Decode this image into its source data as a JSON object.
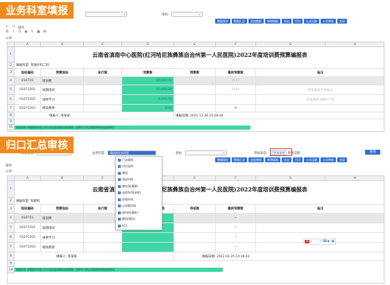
{
  "top": {
    "section_label": "业务科室填报",
    "filter_label": "指标:",
    "toolbar_label": "操作",
    "formula_label": "公式:",
    "buttons": [
      "数据保存",
      "数据汇总",
      "追加数据",
      "新增填报",
      "导出",
      "打印",
      "公式运算",
      "公式审核",
      "关闭"
    ],
    "columns": [
      "A",
      "B",
      "C",
      "D",
      "E",
      "F",
      "G",
      "H"
    ],
    "title": "云南省滇南中心医院(红河哈尼族彝族自治州第一人民医院)2022年度培训费预算编报表",
    "unit_line": "填报科室: 普通外科二科",
    "headers": [
      "指标编码",
      "预算指标",
      "执行数",
      "预算数",
      "预算数",
      "最终预算数",
      "备注"
    ],
    "rows": [
      {
        "num": "4",
        "code": "010715",
        "name": "培训费",
        "exec": "",
        "budget": "00,000.00",
        "b2": "",
        "final": "0000",
        "note": ""
      },
      {
        "num": "5",
        "code": "01071501",
        "name": "短期培训",
        "exec": "",
        "budget": "00,000.00",
        "b2": "",
        "final": "0000",
        "note": "参加相关学术会议"
      },
      {
        "num": "6",
        "code": "01071502",
        "name": "进修学习",
        "exec": "",
        "budget": "0,000.00",
        "b2": "",
        "final": "",
        "note": "外出进修 进修6个月"
      },
      {
        "num": "7",
        "code": "01071503",
        "name": "继续教育",
        "exec": "",
        "budget": "0.00",
        "b2": "",
        "final": "0",
        "note": ""
      }
    ],
    "sign_left": "填报人: 某某某",
    "sign_right": "填报日期: 2021-11-26 15:08:44",
    "note": "填报说明: 请根据本科室工作计划如实填报培训费预算，进修学习须注明进修时间及进修单位"
  },
  "bottom": {
    "section_label": "归口汇总审核",
    "filter_status_label": "审核状态:",
    "filter_dept_label": "业务科室:",
    "filter_dept_value": "请选择业务科室",
    "filter_indicator_label": "指标:",
    "filter_audit_label": "审核状态:",
    "filter_audit_value": "已完成审核",
    "filter_extra": "审核日期",
    "query_label": "查询",
    "toolbar_label": "操作",
    "formula_label": "公式:",
    "buttons": [
      "数据保存",
      "数据汇总",
      "追加数据",
      "新增填报",
      "导出",
      "打印",
      "公式运算",
      "公式审核",
      "关闭"
    ],
    "columns": [
      "A",
      "B",
      "C",
      "D",
      "E",
      "F",
      "G",
      "H"
    ],
    "title": "云南省滇南中心医院(红河哈尼族彝族自治州第一人民医院)2022年度培训费预算编报表",
    "unit_line": "填报科室: 科教科",
    "headers": [
      "指标编码",
      "预算指标",
      "执行数",
      "预算数",
      "审核数",
      "审核数",
      "最终预算数",
      "备注"
    ],
    "rows": [
      {
        "num": "4",
        "code": "010715",
        "name": "培训费"
      },
      {
        "num": "5",
        "code": "01071501",
        "name": "短期培训"
      },
      {
        "num": "6",
        "code": "01071502",
        "name": "进修学习"
      },
      {
        "num": "7",
        "code": "01071503",
        "name": "继续教育"
      }
    ],
    "final_values": [
      "—",
      "—",
      "—",
      "—"
    ],
    "sign_left": "填报人: 李某某",
    "sign_right": "填报日期: 2022-02-25 14:36:42",
    "note": "填报说明: 请根据本科室工作计划如实填报培训费预算，进修学习须注明进修时间及进修单位",
    "dropdown_items": [
      "门诊部科",
      "内分泌科",
      "骨科",
      "消化内科",
      "普外科(胃肠)",
      "泌尿外科(泌尿)",
      "肝胆外科",
      "心血管内科",
      "肾内科(透析)",
      "眼科(视光)",
      "ICU"
    ]
  }
}
